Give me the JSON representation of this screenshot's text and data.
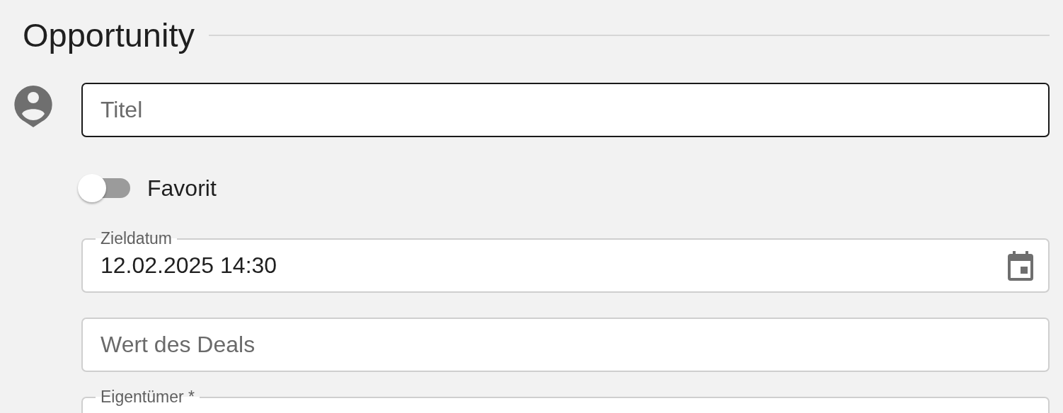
{
  "section": {
    "title": "Opportunity"
  },
  "fields": [
    {
      "kind": "text",
      "placeholder": "Titel",
      "focused": true
    },
    {
      "kind": "switch",
      "label": "Favorit",
      "on": false
    },
    {
      "kind": "date",
      "label": "Zieldatum",
      "value": "12.02.2025 14:30",
      "focused": false
    },
    {
      "kind": "text",
      "placeholder": "Wert des Deals",
      "focused": false
    },
    {
      "kind": "select",
      "label": "Eigentümer *",
      "focused": false
    }
  ]
}
